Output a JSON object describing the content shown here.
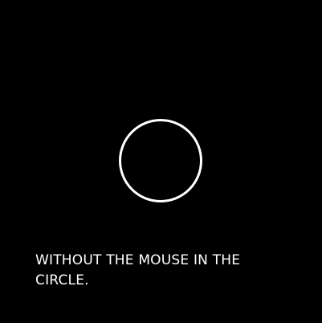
{
  "task": {
    "instruction": "WITHOUT THE MOUSE IN THE CIRCLE."
  },
  "theme": {
    "background": "#000000",
    "foreground": "#ffffff"
  },
  "elements": {
    "circle_icon": "circle-outline"
  }
}
